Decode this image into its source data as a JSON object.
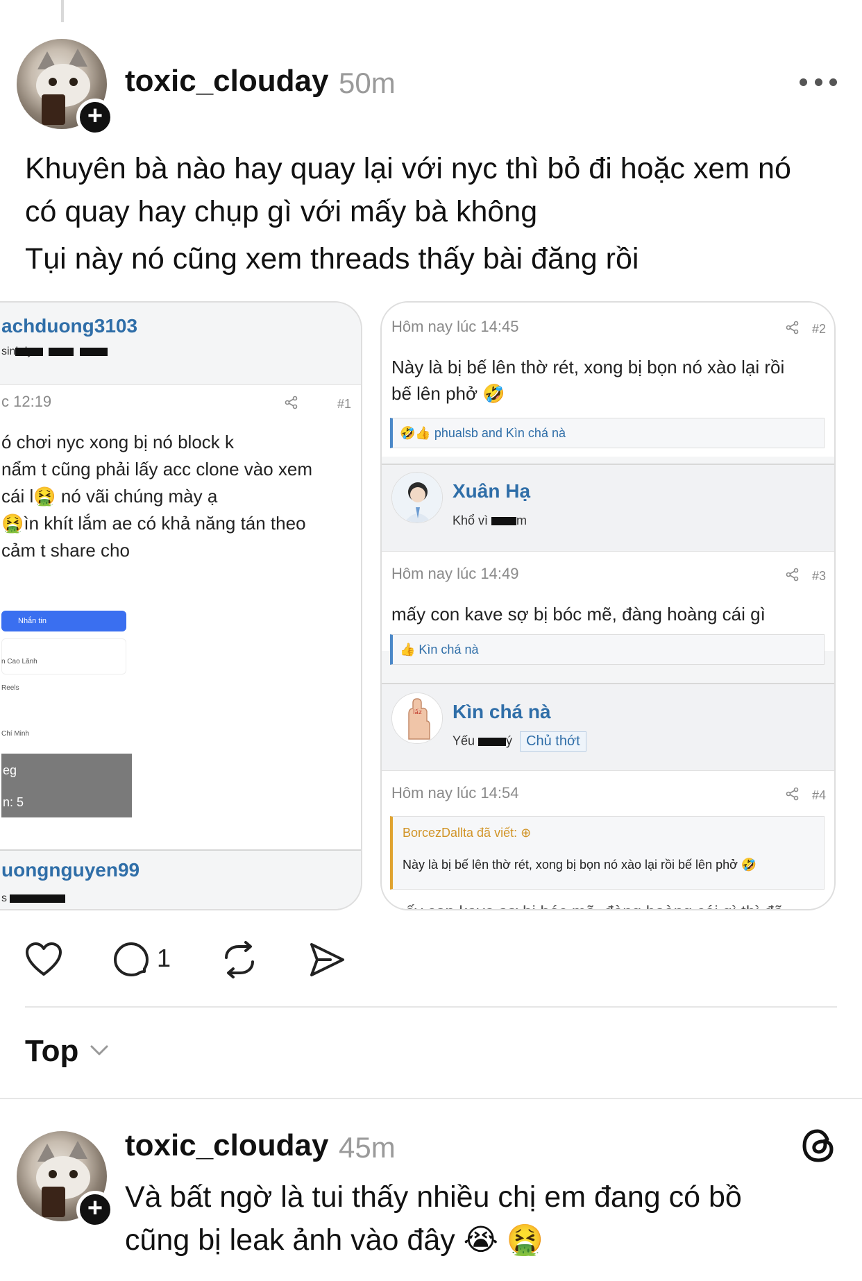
{
  "post": {
    "username": "toxic_clouday",
    "time": "50m",
    "lines": [
      "Khuyên bà nào hay quay lại với nyc thì bỏ đi hoặc xem nó",
      "có quay hay chụp gì với mấy bà không",
      "Tụi này nó cũng xem threads thấy bài đăng rồi"
    ],
    "reply_count": "1",
    "avatar_plus": "+"
  },
  "left_card": {
    "username": "achduong3103",
    "subtitle": "sinh ly",
    "date": "c 12:19",
    "share_glyph": "⋖",
    "post_no": "#1",
    "lines": [
      "ó chơi nyc xong bị nó block k",
      "nẩm t cũng phải lấy acc clone vào xem",
      " cái l🤮 nó vãi chúng mày ạ",
      "🤮ìn khít lắm ae có khả năng tán theo",
      "cảm t share cho"
    ],
    "button_label": "Nhắn tin",
    "small_lines": [
      "n Cao Lãnh",
      "Reels",
      "Chí Minh"
    ],
    "dark_a": "eg",
    "dark_b": "n: 5",
    "footer_username": "uongnguyen99",
    "footer_sub": "s"
  },
  "right_card": {
    "posts": [
      {
        "date": "Hôm nay lúc 14:45",
        "no": "#2",
        "text_1": "Này là bị bế lên thờ rét, xong bị bọn nó xào lại rồi",
        "text_2": "bế lên phở 🤣",
        "reactions": "🤣👍 phualsb and Kìn chá nà"
      },
      {
        "date": "Hôm nay lúc 14:49",
        "no": "#3",
        "text_1": "mấy con kave sợ bị bóc mẽ, đàng hoàng cái gì",
        "reactions": "👍 Kìn chá nà"
      },
      {
        "date": "Hôm nay lúc 14:54",
        "no": "#4",
        "quote_head": "BorcezDallta đã viết: ⊕",
        "quote_text": "Này là bị bế lên thờ rét, xong bị bọn nó xào lại rồi bế lên phở 🤣"
      }
    ],
    "users": [
      {
        "name": "Xuân Hạ",
        "title_a": "Khổ vì",
        "title_b": "m"
      },
      {
        "name": "Kìn chá nà",
        "title_a": "Yếu",
        "title_b": "ý",
        "badge": "Chủ thớt"
      }
    ],
    "cut_text": "mấy con kave sợ bị bóc mẽ, đàng hoàng cái gì thì đã"
  },
  "sort": {
    "label": "Top"
  },
  "reply": {
    "username": "toxic_clouday",
    "time": "45m",
    "line_1": "Và bất ngờ là tui thấy nhiều chị em đang có bồ",
    "line_2": "cũng bị leak ảnh vào đây 😭 🤮"
  },
  "icons": {
    "like": "heart-icon",
    "reply": "comment-icon",
    "repost": "repost-icon",
    "share": "send-icon",
    "more": "more-icon",
    "threads": "threads-logo-icon",
    "chevron": "chevron-down-icon"
  }
}
